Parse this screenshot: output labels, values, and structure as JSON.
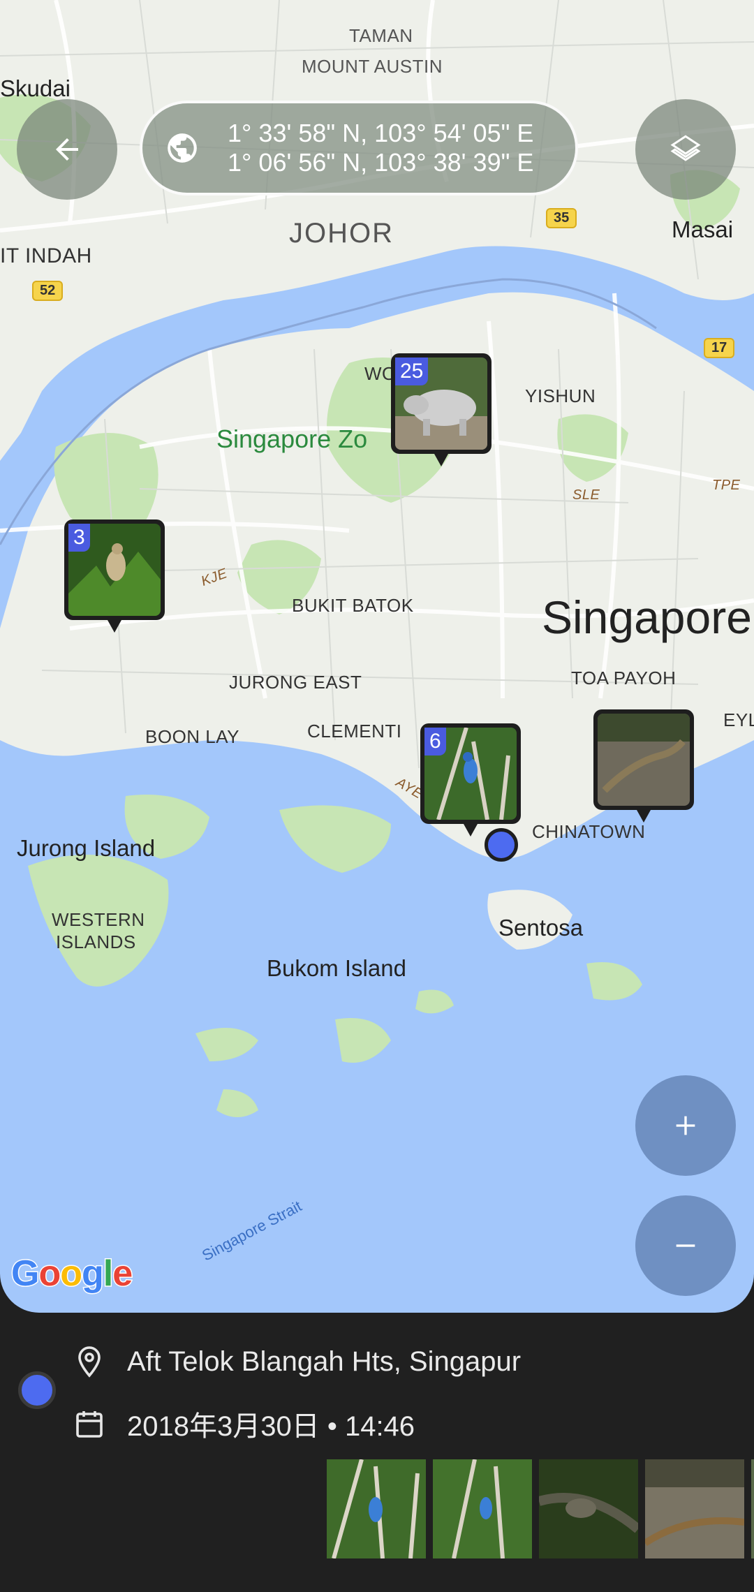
{
  "map": {
    "coords": {
      "line1": "1° 33' 58\" N, 103° 54' 05\" E",
      "line2": "1° 06' 56\" N, 103° 38' 39\" E"
    },
    "labels": {
      "taman": "TAMAN",
      "mount_austin": "MOUNT AUSTIN",
      "skudai": "Skudai",
      "johor": "JOHOR",
      "masai": "Masai",
      "bukit_indah": "IT INDAH",
      "woodlands": "WO",
      "yishun": "YISHUN",
      "singapore_zoo": "Singapore Zo",
      "bukit_batok": "BUKIT BATOK",
      "singapore": "Singapore",
      "jurong_east": "JURONG EAST",
      "toa_payoh": "TOA PAYOH",
      "boon_lay": "BOON LAY",
      "clementi": "CLEMENTI",
      "geylang": "EYLAN",
      "chinatown": "CHINATOWN",
      "jurong_island": "Jurong Island",
      "western": "WESTERN",
      "islands": "ISLANDS",
      "sentosa": "Sentosa",
      "bukom_island": "Bukom Island",
      "singapore_strait": "Singapore Strait",
      "kje": "KJE",
      "sle": "SLE",
      "tpe": "TPE",
      "aye": "AYE"
    },
    "shields": {
      "s35": "35",
      "s52": "52",
      "s17": "17"
    },
    "markers": [
      {
        "count": "25",
        "subject": "rhinoceros"
      },
      {
        "count": "3",
        "subject": "bird-in-tree"
      },
      {
        "count": "6",
        "subject": "kingfisher"
      },
      {
        "count": "",
        "subject": "lizard"
      }
    ],
    "google_logo": [
      "G",
      "o",
      "o",
      "g",
      "l",
      "e"
    ],
    "google_colors": [
      "#4285F4",
      "#EA4335",
      "#FBBC05",
      "#4285F4",
      "#34A853",
      "#EA4335"
    ]
  },
  "controls": {
    "back_icon": "arrow-left-icon",
    "layers_icon": "layers-icon",
    "zoom_in_icon": "plus-icon",
    "zoom_out_icon": "minus-icon",
    "globe_icon": "globe-icon"
  },
  "details": {
    "place": "Aft Telok Blangah Hts, Singapur",
    "datetime": "2018年3月30日 • 14:46",
    "place_icon": "location-pin-icon",
    "date_icon": "calendar-icon"
  },
  "thumbnails": [
    "kingfisher-1",
    "kingfisher-2",
    "bird-branch",
    "lizard",
    "more"
  ],
  "colors": {
    "water": "#a3c7fb",
    "land": "#eef0ea",
    "park": "#c7e5b4",
    "accent_blue": "#4d6bf0",
    "panel_bg": "#202020"
  }
}
